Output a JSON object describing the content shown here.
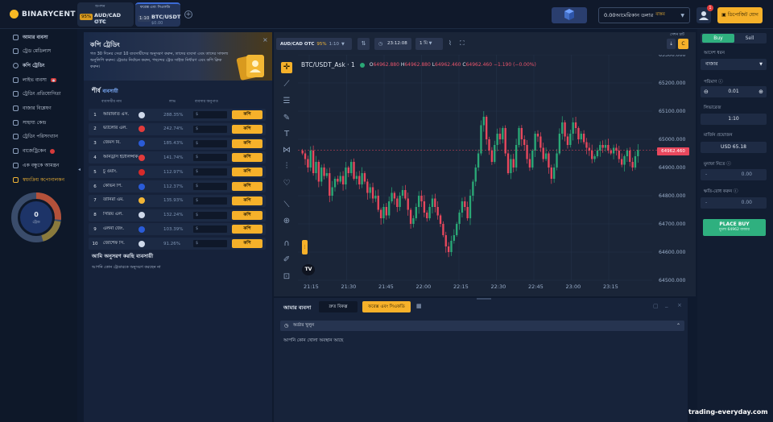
{
  "brand": {
    "name": "BINARYCENT"
  },
  "tabs": [
    {
      "badge": "95%",
      "label": "AUD/CAD OTC",
      "sub": "$1.72",
      "top": ""
    },
    {
      "badge": "1:10",
      "label": "BTC/USDT",
      "sub": "$0.00",
      "top": "ফরেক্স এবং সিএফডি"
    }
  ],
  "tabs_top0": "অপশন",
  "header": {
    "balance": "0.00আমেরিকান ডলার",
    "balance_mode": "বাস্তব",
    "notif_count": "1",
    "deposit": "ডিপোজিট যোগ"
  },
  "sidebar": {
    "items": [
      "আমার ব্যবসা",
      "ট্রেড মেডিলাস",
      "কপি ট্রেডিং",
      "লাইভ ব্যবসা",
      "ট্রেডিং প্রতিযোগিতা",
      "বাজার বিশ্লেষণ",
      "সাহায্য কেন্দ্র",
      "ট্রেডিং পরিসংখ্যান",
      "বাজেট্রিকেন",
      "এক বন্ধুকে আমন্ত্রন",
      "স্বয়ংক্রিয় কপোনালকন"
    ],
    "gauge_value": "0",
    "gauge_label": "ট্রেড"
  },
  "copy": {
    "title": "কপি ট্রেডিং",
    "desc": "গত 30 দিনের সেরা 10 ব্যবসায়ীদের অনুসরণ করুন, তাদের ব্যবসা এবং তাদের সাফল্য অনুলিপি করুন। ট্রেডার নির্বাচন করুন, পছন্দের ট্রেড সাইজ নির্ধারণ এবং কপি ক্লিক করুন।",
    "top_title": "শীর্ষ",
    "top_sub": "ব্যবসায়ী",
    "col_name": "ব্যবসায়ীর নাম",
    "col_profit": "লাভ",
    "col_amount": "ব্যবসার অনুপাত",
    "copy_label": "কপি",
    "placeholder": "$",
    "traders": [
      {
        "rank": "1",
        "name": "আরাফাত এস.",
        "profit": "288.35%"
      },
      {
        "rank": "2",
        "name": "ভ্যালেরি এল.",
        "profit": "242.74%"
      },
      {
        "rank": "3",
        "name": "জেমস বি.",
        "profit": "185.43%"
      },
      {
        "rank": "4",
        "name": "আনড্রাস ইটালিন্সকি",
        "profit": "141.74%"
      },
      {
        "rank": "5",
        "name": "চু ওয়াং.",
        "profit": "112.97%"
      },
      {
        "rank": "6",
        "name": "কেভিন পি.",
        "profit": "112.37%"
      },
      {
        "rank": "7",
        "name": "তানিরা এম.",
        "profit": "135.93%"
      },
      {
        "rank": "8",
        "name": "সিরিয় এল.",
        "profit": "132.24%"
      },
      {
        "rank": "9",
        "name": "এলনা জেং.",
        "profit": "103.39%"
      },
      {
        "rank": "10",
        "name": "জোশেফ সি.",
        "profit": "91.26%"
      }
    ],
    "follow_title": "আমি অনুসরণ করছি ব্যবসায়ী",
    "follow_empty": "আপনি কোন ট্রেডারকে অনুসরণ করছেন না"
  },
  "chart_toolbar": {
    "asset": "AUD/CAD OTC",
    "pct": "95%",
    "ratio": "1:10",
    "time": "23:12:08",
    "interval": "1 মি",
    "right_label": "সেশন চার্ট",
    "right_val": "C"
  },
  "chart": {
    "symbol": "BTC/USDT_Ask · 1",
    "o": "64962.880",
    "h": "64962.880",
    "l": "64962.460",
    "c": "64962.460",
    "chg": "−1.190 (−0.00%)",
    "price_tag": "64962.460",
    "tv": "TV"
  },
  "trades": {
    "title": "আমার ব্যবসা",
    "tab1": "দ্রুত বিকল্প",
    "tab2": "ফরেক্স এবং সিএফডি",
    "section": "অর্ডার খুলুন",
    "empty": "আপনি কোন খোলা অবস্থান আছে"
  },
  "right": {
    "buy": "Buy",
    "sell": "Sell",
    "order_type_label": "আদেশ ধরন",
    "order_type": "বাজার",
    "amount_label": "পরিমাণ",
    "amount": "0.01",
    "leverage_label": "লিভারেজ",
    "leverage": "1:10",
    "margin_label": "মার্জিন প্রয়োজন",
    "margin": "USD 65.18",
    "tp_label": "মুনাফা নিতে",
    "tp": "0.00",
    "sl_label": "ক্ষতি-রোধ করুন",
    "sl": "0.00",
    "place": "PLACE BUY",
    "place_sub": "মূল্যে 64962 বাজার"
  },
  "watermark": "trading-everyday.com",
  "chart_data": {
    "type": "candlestick",
    "x_ticks": [
      "21:15",
      "21:30",
      "21:45",
      "22:00",
      "22:15",
      "22:30",
      "22:45",
      "23:00",
      "23:15"
    ],
    "y_ticks": [
      "65300.000",
      "65200.000",
      "65100.000",
      "65000.000",
      "64900.000",
      "64800.000",
      "64700.000",
      "64600.000",
      "64500.000"
    ],
    "ylim": [
      64500,
      65300
    ],
    "closes": [
      64950,
      64930,
      64900,
      64960,
      64880,
      64920,
      64850,
      64900,
      64870,
      64880,
      64800,
      64830,
      64860,
      64850,
      64870,
      64840,
      64900,
      64880,
      64920,
      64860,
      64870,
      64840,
      64880,
      64850,
      64810,
      64830,
      64790,
      64800,
      64750,
      64720,
      64760,
      64730,
      64780,
      64810,
      64790,
      64760,
      64800,
      64820,
      64790,
      64750,
      64700,
      64720,
      64760,
      64800,
      64780,
      64740,
      64720,
      64760,
      64790,
      64760,
      64730,
      64700,
      64660,
      64620,
      64600,
      64640,
      64660,
      64700,
      64740,
      64780,
      64760,
      64720,
      64800,
      64850,
      64900,
      64950,
      65050,
      65080,
      65000,
      64960,
      64920,
      64980,
      65020,
      65000,
      65040,
      64950,
      64880,
      64930,
      64900,
      64980,
      65040,
      65000,
      64980,
      64930,
      64900,
      64960,
      65020,
      65010,
      64970,
      64930,
      64950,
      64900,
      64860,
      64900,
      64950,
      65020,
      65060,
      65010,
      64980,
      65020,
      65060,
      65040,
      65000,
      65020,
      64990,
      64970,
      64960,
      64930,
      64940,
      64960,
      64980,
      64970,
      64980,
      64960,
      64950,
      64970,
      64960,
      64930,
      64910,
      64940,
      64960,
      64920,
      64900,
      64940,
      64962
    ]
  }
}
